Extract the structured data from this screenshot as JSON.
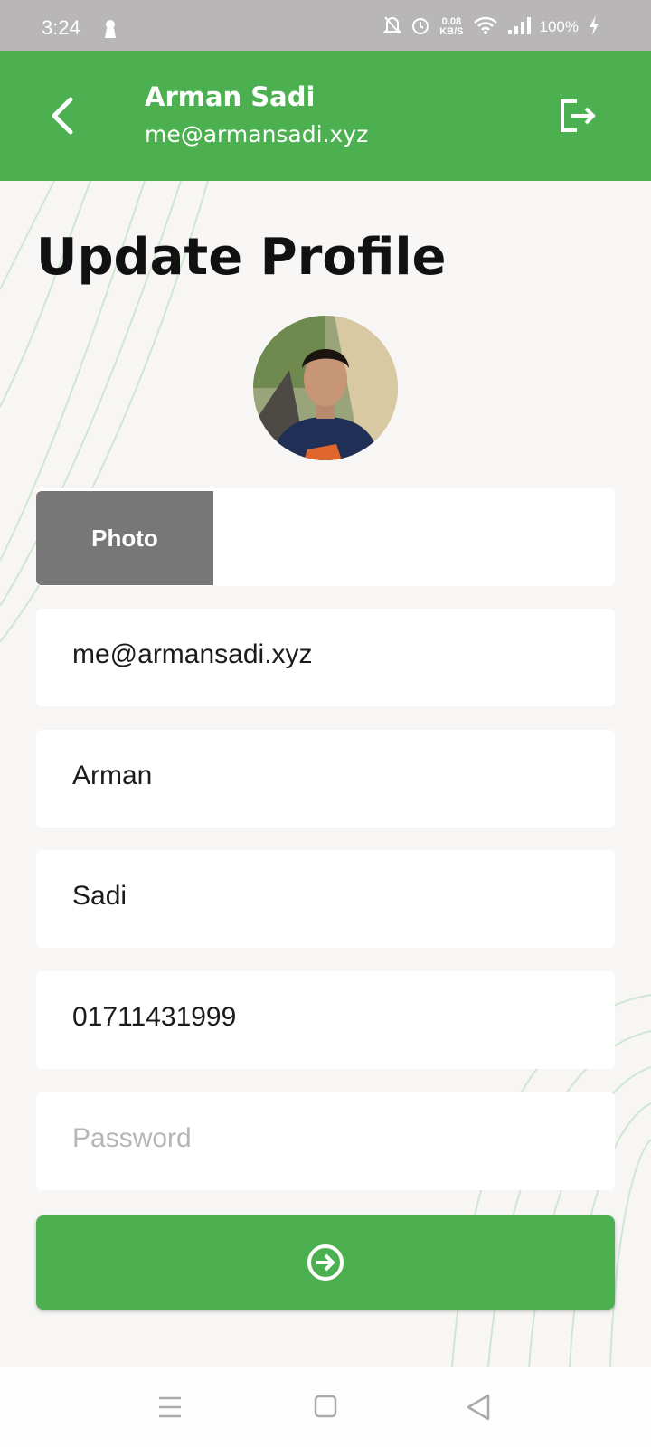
{
  "status_bar": {
    "time": "3:24",
    "net_speed_value": "0.08",
    "net_speed_unit": "KB/S",
    "battery": "100%"
  },
  "header": {
    "name": "Arman Sadi",
    "email": "me@armansadi.xyz"
  },
  "page": {
    "title": "Update Profile"
  },
  "form": {
    "photo_button_label": "Photo",
    "email_value": "me@armansadi.xyz",
    "first_name_value": "Arman",
    "last_name_value": "Sadi",
    "phone_value": "01711431999",
    "password_placeholder": "Password"
  },
  "icons": {
    "back": "back-arrow-icon",
    "logout": "logout-icon",
    "submit": "arrow-circle-right-icon",
    "nav_menu": "menu-icon",
    "nav_home": "square-home-icon",
    "nav_back": "triangle-back-icon"
  },
  "colors": {
    "primary": "#4caf50",
    "photo_button": "#777777",
    "background": "#f7f6f5",
    "status_bar": "#b8b6b6"
  }
}
